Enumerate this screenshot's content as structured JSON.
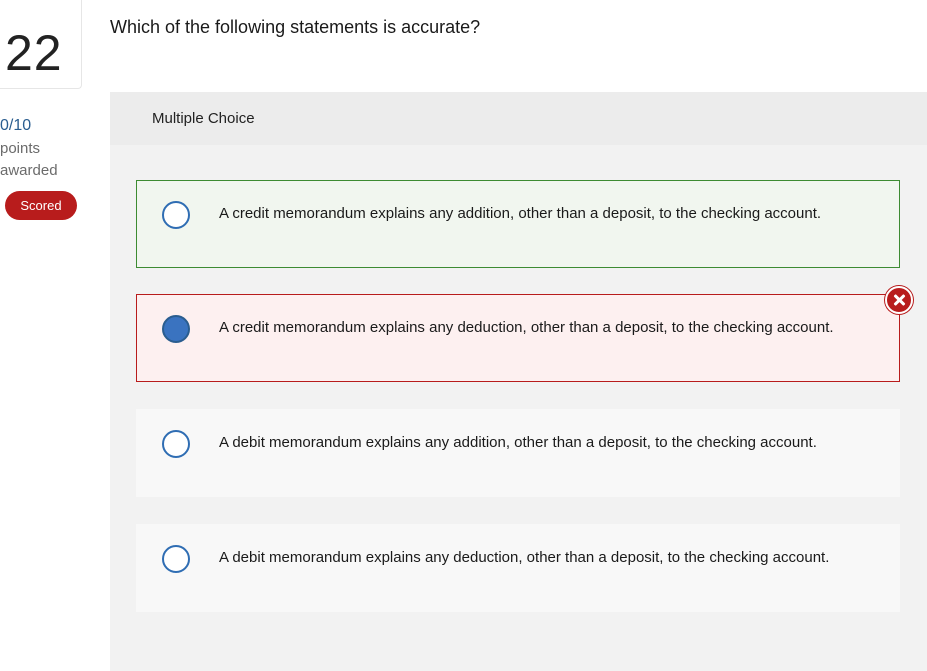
{
  "question": {
    "number": "22",
    "text": "Which of the following statements is accurate?"
  },
  "score": {
    "value": "0/10",
    "label_line1": "points",
    "label_line2": "awarded",
    "badge": "Scored"
  },
  "panel": {
    "header": "Multiple Choice"
  },
  "options": [
    {
      "text": "A credit memorandum explains any addition, other than a deposit, to the checking account.",
      "selected": false,
      "status": "correct"
    },
    {
      "text": "A credit memorandum explains any deduction, other than a deposit, to the checking account.",
      "selected": true,
      "status": "incorrect"
    },
    {
      "text": "A debit memorandum explains any addition, other than a deposit, to the checking account.",
      "selected": false,
      "status": "neutral"
    },
    {
      "text": "A debit memorandum explains any deduction, other than a deposit, to the checking account.",
      "selected": false,
      "status": "neutral"
    }
  ],
  "colors": {
    "correct_border": "#3d8b32",
    "incorrect_border": "#b81c1c",
    "radio_selected": "#3a73c0"
  },
  "icons": {
    "incorrect_marker": "x-circle-icon"
  }
}
